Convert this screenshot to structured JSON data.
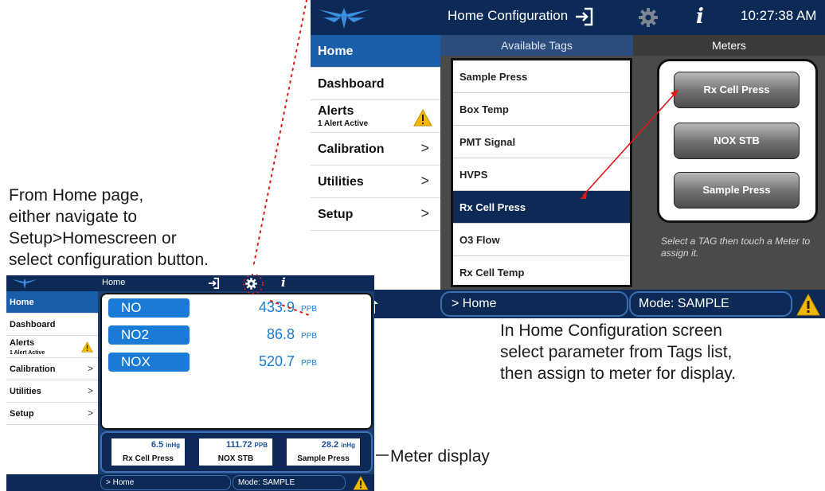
{
  "big_screen": {
    "title": "Home Configuration",
    "time": "10:27:38 AM",
    "nav": [
      {
        "label": "Home",
        "active": true,
        "chevron": ""
      },
      {
        "label": "Dashboard",
        "chevron": ""
      },
      {
        "label": "Alerts",
        "sub": "1 Alert Active",
        "chevron": ""
      },
      {
        "label": "Calibration",
        "chevron": ">"
      },
      {
        "label": "Utilities",
        "chevron": ">"
      },
      {
        "label": "Setup",
        "chevron": ">"
      }
    ],
    "available_tags_header": "Available Tags",
    "tags": [
      "Sample Press",
      "Box Temp",
      "PMT Signal",
      "HVPS",
      "Rx Cell Press",
      "O3 Flow",
      "Rx Cell Temp"
    ],
    "selected_tag": "Rx Cell Press",
    "meters_header": "Meters",
    "meters": [
      "Rx Cell Press",
      "NOX STB",
      "Sample Press"
    ],
    "hint": "Select a TAG then touch a Meter to assign it.",
    "breadcrumb": "> Home",
    "mode": "Mode: SAMPLE"
  },
  "small_screen": {
    "title": "Home",
    "nav": [
      {
        "label": "Home",
        "active": true,
        "chevron": ""
      },
      {
        "label": "Dashboard",
        "chevron": ""
      },
      {
        "label": "Alerts",
        "sub": "1 Alert Active",
        "chevron": ""
      },
      {
        "label": "Calibration",
        "chevron": ">"
      },
      {
        "label": "Utilities",
        "chevron": ">"
      },
      {
        "label": "Setup",
        "chevron": ">"
      }
    ],
    "readings": [
      {
        "name": "NO",
        "value": "433.9",
        "unit": "PPB"
      },
      {
        "name": "NO2",
        "value": "86.8",
        "unit": "PPB"
      },
      {
        "name": "NOX",
        "value": "520.7",
        "unit": "PPB"
      }
    ],
    "meters": [
      {
        "value": "6.5",
        "unit": "inHg",
        "label": "Rx Cell Press"
      },
      {
        "value": "111.72",
        "unit": "PPB",
        "label": "NOX STB"
      },
      {
        "value": "28.2",
        "unit": "inHg",
        "label": "Sample Press"
      }
    ],
    "breadcrumb": "> Home",
    "mode": "Mode: SAMPLE"
  },
  "annotations": {
    "left_note": [
      "From Home page,",
      "either navigate to",
      "Setup>Homescreen or",
      "select configuration button."
    ],
    "right_note": [
      "In Home Configuration screen",
      "select parameter from Tags list,",
      "then assign to meter for display."
    ],
    "meter_note": "Meter display"
  },
  "colors": {
    "navy": "#0c2a55",
    "panel_blue": "#1c3f73",
    "accent_blue": "#1a7bd6",
    "active_nav": "#1a5da8",
    "warning": "#f5b800",
    "annotation_red": "#e01818"
  },
  "icons": {
    "logo": "teledyne-logo-icon",
    "exit": "exit-icon",
    "settings": "gear-icon",
    "info": "info-icon",
    "home": "home-icon",
    "warning": "warning-icon"
  }
}
